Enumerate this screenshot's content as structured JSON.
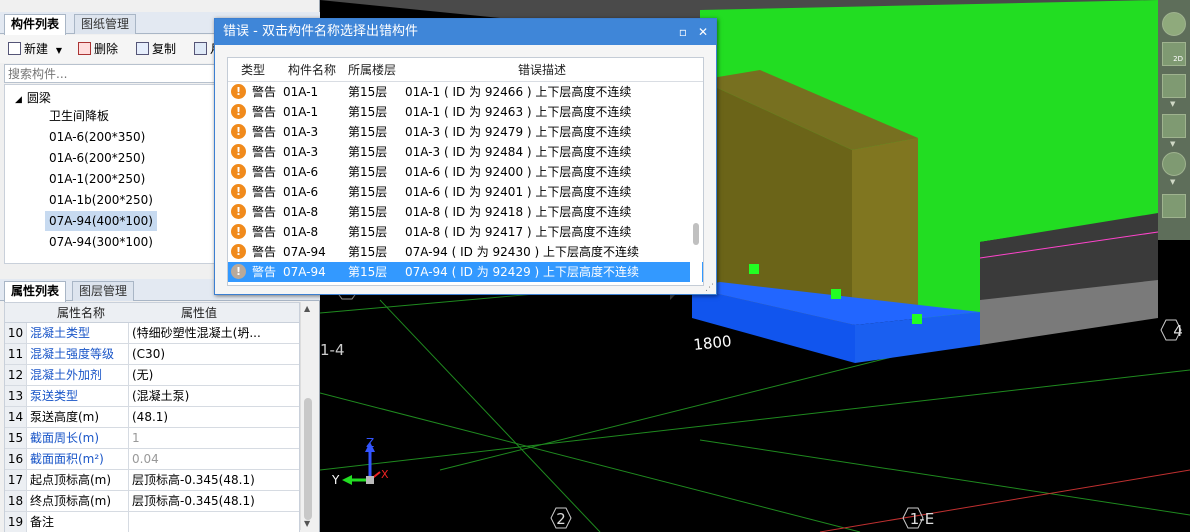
{
  "component_panel": {
    "tabs": [
      {
        "label": "构件列表"
      },
      {
        "label": "图纸管理"
      }
    ],
    "toolbar": {
      "new_label": "新建",
      "delete_label": "删除",
      "copy_label": "复制",
      "extra_label": "月"
    },
    "search_placeholder": "搜索构件...",
    "tree": {
      "root": "圆梁",
      "items": [
        {
          "label": "卫生间降板"
        },
        {
          "label": "01A-6(200*350)"
        },
        {
          "label": "01A-6(200*250)"
        },
        {
          "label": "01A-1(200*250)"
        },
        {
          "label": "01A-1b(200*250)"
        },
        {
          "label": "07A-94(400*100)"
        },
        {
          "label": "07A-94(300*100)"
        }
      ],
      "selected_index": 5
    }
  },
  "property_panel": {
    "tabs": [
      {
        "label": "属性列表"
      },
      {
        "label": "图层管理"
      }
    ],
    "headers": {
      "name": "属性名称",
      "value": "属性值"
    },
    "rows": [
      {
        "num": "10",
        "name": "混凝土类型",
        "value": "(特细砂塑性混凝土(坍...",
        "name_style": "blue"
      },
      {
        "num": "11",
        "name": "混凝土强度等级",
        "value": "(C30)",
        "name_style": "blue"
      },
      {
        "num": "12",
        "name": "混凝土外加剂",
        "value": "(无)",
        "name_style": "blue"
      },
      {
        "num": "13",
        "name": "泵送类型",
        "value": "(混凝土泵)",
        "name_style": "blue"
      },
      {
        "num": "14",
        "name": "泵送高度(m)",
        "value": "(48.1)",
        "name_style": "black"
      },
      {
        "num": "15",
        "name": "截面周长(m)",
        "value": "1",
        "name_style": "blue-gray"
      },
      {
        "num": "16",
        "name": "截面面积(m²)",
        "value": "0.04",
        "name_style": "blue-gray"
      },
      {
        "num": "17",
        "name": "起点顶标高(m)",
        "value": "层顶标高-0.345(48.1)",
        "name_style": "black"
      },
      {
        "num": "18",
        "name": "终点顶标高(m)",
        "value": "层顶标高-0.345(48.1)",
        "name_style": "black"
      },
      {
        "num": "19",
        "name": "备注",
        "value": "",
        "name_style": "black"
      }
    ]
  },
  "error_dialog": {
    "title": "错误 - 双击构件名称选择出错构件",
    "columns": {
      "type": "类型",
      "name": "构件名称",
      "floor": "所属楼层",
      "desc": "错误描述"
    },
    "rows": [
      {
        "type": "警告",
        "name": "01A-1",
        "floor": "第15层",
        "desc": "01A-1 ( ID 为 92466 ) 上下层高度不连续"
      },
      {
        "type": "警告",
        "name": "01A-1",
        "floor": "第15层",
        "desc": "01A-1 ( ID 为 92463 ) 上下层高度不连续"
      },
      {
        "type": "警告",
        "name": "01A-3",
        "floor": "第15层",
        "desc": "01A-3 ( ID 为 92479 ) 上下层高度不连续"
      },
      {
        "type": "警告",
        "name": "01A-3",
        "floor": "第15层",
        "desc": "01A-3 ( ID 为 92484 ) 上下层高度不连续"
      },
      {
        "type": "警告",
        "name": "01A-6",
        "floor": "第15层",
        "desc": "01A-6 ( ID 为 92400 ) 上下层高度不连续"
      },
      {
        "type": "警告",
        "name": "01A-6",
        "floor": "第15层",
        "desc": "01A-6 ( ID 为 92401 ) 上下层高度不连续"
      },
      {
        "type": "警告",
        "name": "01A-8",
        "floor": "第15层",
        "desc": "01A-8 ( ID 为 92418 ) 上下层高度不连续"
      },
      {
        "type": "警告",
        "name": "01A-8",
        "floor": "第15层",
        "desc": "01A-8 ( ID 为 92417 ) 上下层高度不连续"
      },
      {
        "type": "警告",
        "name": "07A-94",
        "floor": "第15层",
        "desc": "07A-94 ( ID 为 92430 ) 上下层高度不连续"
      },
      {
        "type": "警告",
        "name": "07A-94",
        "floor": "第15层",
        "desc": "07A-94 ( ID 为 92429 ) 上下层高度不连续"
      }
    ],
    "selected_index": 9,
    "warning_glyph": "!"
  },
  "viewport": {
    "dimension_label": "1800",
    "axis_labels": {
      "a1": "1-4",
      "a2": "2",
      "a3": "1-E",
      "a4": "4"
    },
    "axes": {
      "z": "Z",
      "y": "Y",
      "x": "X"
    },
    "view_cube_label": "2D"
  },
  "icons": {
    "new": "new-document-icon",
    "delete": "delete-icon",
    "copy": "copy-icon",
    "minimize": "restore-icon",
    "close": "close-icon",
    "warning": "warning-icon",
    "globe": "globe-icon"
  },
  "colors": {
    "dialog_title": "#3f86d8",
    "selection": "#3399ff",
    "warning": "#f08a1c",
    "slab_green": "#22dd22",
    "beam_olive": "#6b6418",
    "beam_blue": "#1155ee"
  }
}
